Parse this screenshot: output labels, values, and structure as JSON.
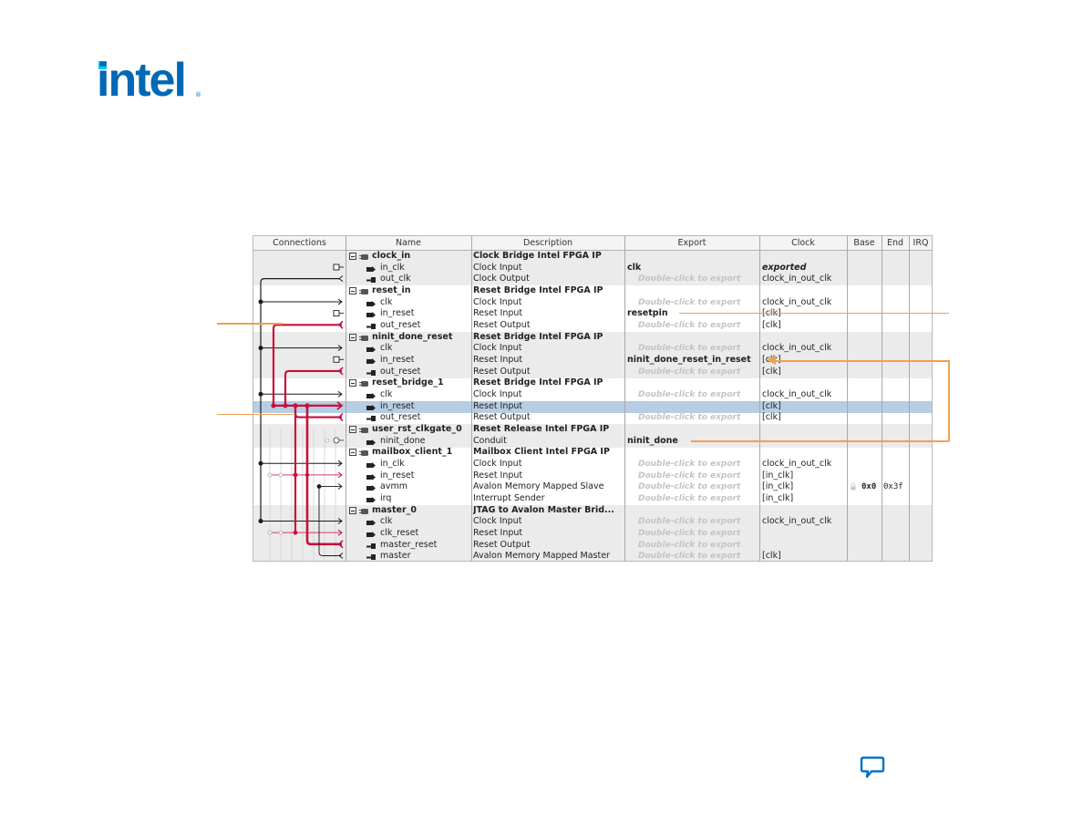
{
  "brand": {
    "logo_text": "intel",
    "colors": {
      "brand_blue": "#0068b5",
      "accent_cyan": "#00c7fd",
      "reset_line": "#c8103c",
      "callout": "#f0a050",
      "selected_row": "#b7cde3"
    }
  },
  "table": {
    "columns": [
      "Connections",
      "Name",
      "Description",
      "Export",
      "Clock",
      "Base",
      "End",
      "IRQ"
    ],
    "rows": [
      {
        "type": "group",
        "name": "clock_in",
        "description": "Clock Bridge Intel FPGA IP",
        "export": "",
        "clock": "",
        "base": "",
        "end": "",
        "irq": ""
      },
      {
        "type": "port",
        "dir": "in",
        "name": "in_clk",
        "description": "Clock Input",
        "export": "clk",
        "export_style": "bold",
        "clock": "exported",
        "clock_style": "italic-bold"
      },
      {
        "type": "port",
        "dir": "out",
        "name": "out_clk",
        "description": "Clock Output",
        "export": "Double-click to export",
        "export_style": "ghost",
        "clock": "clock_in_out_clk"
      },
      {
        "type": "group",
        "name": "reset_in",
        "description": "Reset Bridge Intel FPGA IP"
      },
      {
        "type": "port",
        "dir": "in",
        "name": "clk",
        "description": "Clock Input",
        "export": "Double-click to export",
        "export_style": "ghost",
        "clock": "clock_in_out_clk"
      },
      {
        "type": "port",
        "dir": "in",
        "name": "in_reset",
        "description": "Reset Input",
        "export": "resetpin",
        "export_style": "bold",
        "clock": "[clk]"
      },
      {
        "type": "port",
        "dir": "out",
        "name": "out_reset",
        "description": "Reset Output",
        "export": "Double-click to export",
        "export_style": "ghost",
        "clock": "[clk]"
      },
      {
        "type": "group",
        "name": "ninit_done_reset",
        "description": "Reset Bridge Intel FPGA IP"
      },
      {
        "type": "port",
        "dir": "in",
        "name": "clk",
        "description": "Clock Input",
        "export": "Double-click to export",
        "export_style": "ghost",
        "clock": "clock_in_out_clk"
      },
      {
        "type": "port",
        "dir": "in",
        "name": "in_reset",
        "description": "Reset Input",
        "export": "ninit_done_reset_in_reset",
        "export_style": "bold",
        "clock": "[clk]"
      },
      {
        "type": "port",
        "dir": "out",
        "name": "out_reset",
        "description": "Reset Output",
        "export": "Double-click to export",
        "export_style": "ghost",
        "clock": "[clk]"
      },
      {
        "type": "group",
        "name": "reset_bridge_1",
        "description": "Reset Bridge Intel FPGA IP"
      },
      {
        "type": "port",
        "dir": "in",
        "name": "clk",
        "description": "Clock Input",
        "export": "Double-click to export",
        "export_style": "ghost",
        "clock": "clock_in_out_clk"
      },
      {
        "type": "port",
        "dir": "in",
        "name": "in_reset",
        "description": "Reset Input",
        "export": "Double-click to export",
        "export_style": "ghost-selected",
        "clock": "[clk]",
        "selected": true
      },
      {
        "type": "port",
        "dir": "out",
        "name": "out_reset",
        "description": "Reset Output",
        "export": "Double-click to export",
        "export_style": "ghost",
        "clock": "[clk]"
      },
      {
        "type": "group",
        "name": "user_rst_clkgate_0",
        "description": "Reset Release Intel FPGA IP"
      },
      {
        "type": "port",
        "dir": "in",
        "name": "ninit_done",
        "description": "Conduit",
        "export": "ninit_done",
        "export_style": "bold",
        "clock": ""
      },
      {
        "type": "group",
        "name": "mailbox_client_1",
        "description": "Mailbox Client Intel FPGA IP"
      },
      {
        "type": "port",
        "dir": "in",
        "name": "in_clk",
        "description": "Clock Input",
        "export": "Double-click to export",
        "export_style": "ghost",
        "clock": "clock_in_out_clk"
      },
      {
        "type": "port",
        "dir": "in",
        "name": "in_reset",
        "description": "Reset Input",
        "export": "Double-click to export",
        "export_style": "ghost",
        "clock": "[in_clk]"
      },
      {
        "type": "port",
        "dir": "in",
        "name": "avmm",
        "description": "Avalon Memory Mapped Slave",
        "export": "Double-click to export",
        "export_style": "ghost",
        "clock": "[in_clk]",
        "base": "0x0",
        "end": "0x3f"
      },
      {
        "type": "port",
        "dir": "in",
        "name": "irq",
        "description": "Interrupt Sender",
        "export": "Double-click to export",
        "export_style": "ghost",
        "clock": "[in_clk]"
      },
      {
        "type": "group",
        "name": "master_0",
        "description": "JTAG to Avalon Master Brid..."
      },
      {
        "type": "port",
        "dir": "in",
        "name": "clk",
        "description": "Clock Input",
        "export": "Double-click to export",
        "export_style": "ghost",
        "clock": "clock_in_out_clk"
      },
      {
        "type": "port",
        "dir": "in",
        "name": "clk_reset",
        "description": "Reset Input",
        "export": "Double-click to export",
        "export_style": "ghost",
        "clock": ""
      },
      {
        "type": "port",
        "dir": "out",
        "name": "master_reset",
        "description": "Reset Output",
        "export": "Double-click to export",
        "export_style": "ghost",
        "clock": ""
      },
      {
        "type": "port",
        "dir": "out",
        "name": "master",
        "description": "Avalon Memory Mapped Master",
        "export": "Double-click to export",
        "export_style": "ghost",
        "clock": "[clk]"
      }
    ]
  },
  "icons": {
    "expand": "minus-box-icon",
    "component": "component-chip-icon",
    "port_in": "port-input-icon",
    "port_out": "port-output-icon",
    "lock": "lock-icon",
    "feedback": "chat-bubble-icon"
  }
}
